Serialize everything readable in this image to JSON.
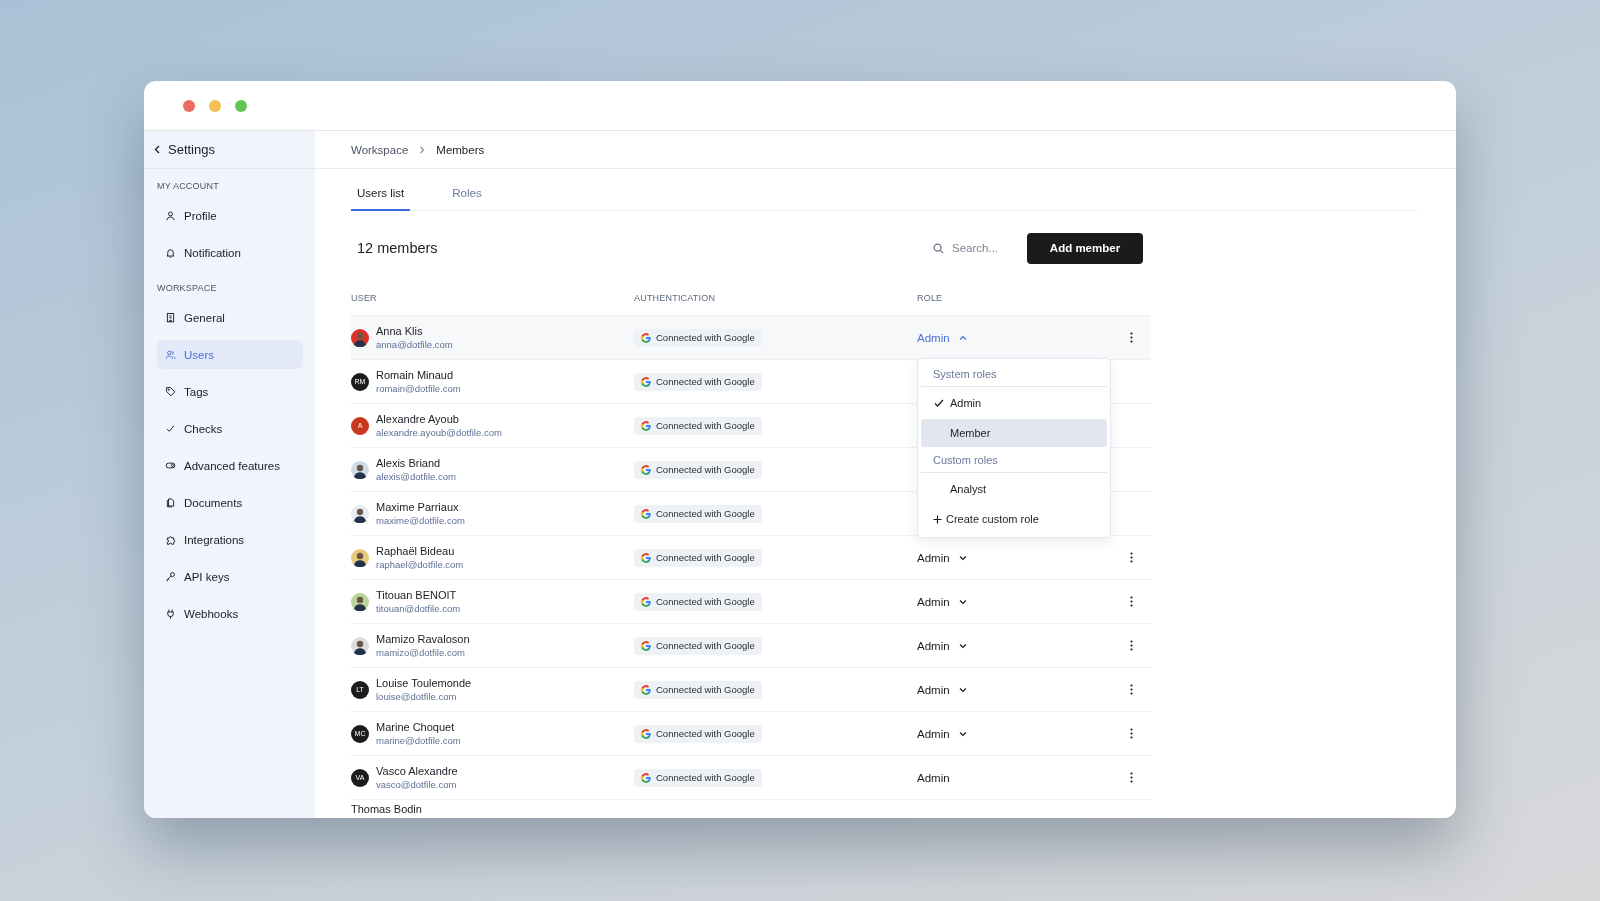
{
  "window": {
    "controls": [
      {
        "color": "#ec6a5e"
      },
      {
        "color": "#f4bf4f"
      },
      {
        "color": "#61c554"
      }
    ]
  },
  "sidebar": {
    "back_label": "Settings",
    "sections": [
      {
        "title": "MY ACCOUNT",
        "items": [
          {
            "label": "Profile",
            "selected": false
          },
          {
            "label": "Notification",
            "selected": false
          }
        ]
      },
      {
        "title": "WORKSPACE",
        "items": [
          {
            "label": "General",
            "selected": false
          },
          {
            "label": "Users",
            "selected": true
          },
          {
            "label": "Tags",
            "selected": false
          },
          {
            "label": "Checks",
            "selected": false
          },
          {
            "label": "Advanced features",
            "selected": false
          },
          {
            "label": "Documents",
            "selected": false
          },
          {
            "label": "Integrations",
            "selected": false
          },
          {
            "label": "API keys",
            "selected": false
          },
          {
            "label": "Webhooks",
            "selected": false
          }
        ]
      }
    ]
  },
  "breadcrumb": [
    "Workspace",
    "Members"
  ],
  "tabs": [
    {
      "label": "Users list",
      "selected": true
    },
    {
      "label": "Roles",
      "selected": false
    }
  ],
  "member_count": "12 members",
  "search": {
    "placeholder": "Search..."
  },
  "add_button": "Add member",
  "table": {
    "columns": [
      "USER",
      "AUTHENTICATION",
      "ROLE"
    ],
    "rows": [
      {
        "name": "Anna Klis",
        "email": "anna@dotfile.com",
        "avatar": {
          "kind": "photo",
          "color": "#d9342b"
        },
        "auth": "Connected with Google",
        "role": "Admin",
        "expanded": true,
        "editable": true,
        "menu": true,
        "highlighted": true
      },
      {
        "name": "Romain Minaud",
        "email": "romain@dotfile.com",
        "avatar": {
          "kind": "initials",
          "text": "RM",
          "color": "#1c1c1e"
        },
        "auth": "Connected with Google",
        "menu": false,
        "highlighted": false
      },
      {
        "name": "Alexandre Ayoub",
        "email": "alexandre.ayoub@dotfile.com",
        "avatar": {
          "kind": "initials",
          "text": "A",
          "color": "#c8381c"
        },
        "auth": "Connected with Google",
        "menu": false,
        "highlighted": false
      },
      {
        "name": "Alexis Briand",
        "email": "alexis@dotfile.com",
        "avatar": {
          "kind": "photo",
          "color": "#cfdbe6"
        },
        "auth": "Connected with Google",
        "menu": false,
        "highlighted": false
      },
      {
        "name": "Maxime Parriaux",
        "email": "maxime@dotfile.com",
        "avatar": {
          "kind": "photo",
          "color": "#e9edf2"
        },
        "auth": "Connected with Google",
        "menu": false,
        "highlighted": false
      },
      {
        "name": "Raphaël Bideau",
        "email": "raphael@dotfile.com",
        "avatar": {
          "kind": "photo",
          "color": "#e5c97a"
        },
        "auth": "Connected with Google",
        "role": "Admin",
        "expanded": false,
        "editable": true,
        "menu": true,
        "highlighted": false
      },
      {
        "name": "Titouan BENOIT",
        "email": "titouan@dotfile.com",
        "avatar": {
          "kind": "photo",
          "color": "#b9d49a"
        },
        "auth": "Connected with Google",
        "role": "Admin",
        "expanded": false,
        "editable": true,
        "menu": true,
        "highlighted": false
      },
      {
        "name": "Mamizo Ravaloson",
        "email": "mamizo@dotfile.com",
        "avatar": {
          "kind": "photo",
          "color": "#dddddd"
        },
        "auth": "Connected with Google",
        "role": "Admin",
        "expanded": false,
        "editable": true,
        "menu": true,
        "highlighted": false
      },
      {
        "name": "Louise Toulemonde",
        "email": "louise@dotfile.com",
        "avatar": {
          "kind": "initials",
          "text": "LT",
          "color": "#1c1c1e"
        },
        "auth": "Connected with Google",
        "role": "Admin",
        "expanded": false,
        "editable": true,
        "menu": true,
        "highlighted": false
      },
      {
        "name": "Marine Choquet",
        "email": "marine@dotfile.com",
        "avatar": {
          "kind": "initials",
          "text": "MC",
          "color": "#1c1c1e"
        },
        "auth": "Connected with Google",
        "role": "Admin",
        "expanded": false,
        "editable": true,
        "menu": true,
        "highlighted": false
      },
      {
        "name": "Vasco Alexandre",
        "email": "vasco@dotfile.com",
        "avatar": {
          "kind": "initials",
          "text": "VA",
          "color": "#1c1c1e"
        },
        "auth": "Connected with Google",
        "role": "Admin",
        "expanded": false,
        "editable": false,
        "menu": true,
        "highlighted": false
      },
      {
        "name": "Thomas Bodin",
        "menu": false,
        "highlighted": false
      }
    ]
  },
  "role_menu": {
    "sections": [
      {
        "title": "System roles",
        "items": [
          {
            "label": "Admin",
            "kind": "option",
            "checked": true,
            "highlighted": false
          },
          {
            "label": "Member",
            "kind": "option",
            "checked": false,
            "highlighted": true
          }
        ]
      },
      {
        "title": "Custom roles",
        "items": [
          {
            "label": "Analyst",
            "kind": "option",
            "checked": false,
            "highlighted": false
          },
          {
            "label": "Create custom role",
            "kind": "create",
            "highlighted": false
          }
        ]
      }
    ]
  }
}
